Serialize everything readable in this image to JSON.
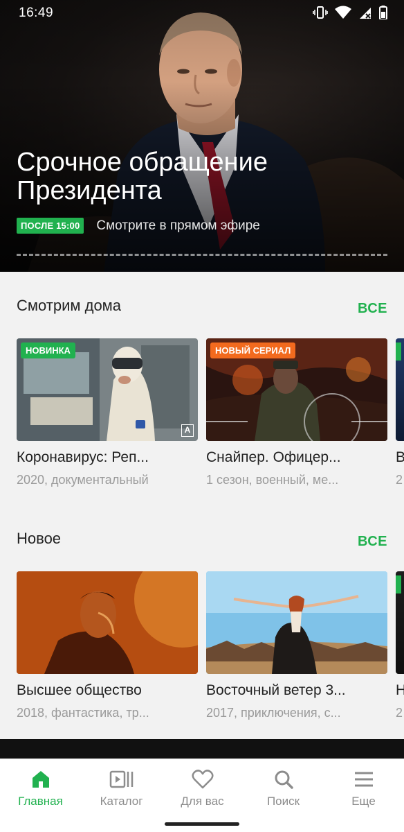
{
  "status_bar": {
    "time": "16:49"
  },
  "hero": {
    "title_line1": "Срочное обращение",
    "title_line2": "Президента",
    "badge": "ПОСЛЕ 15:00",
    "subtitle": "Смотрите в прямом эфире"
  },
  "sections": [
    {
      "title": "Смотрим дома",
      "see_all": "ВСЕ",
      "cards": [
        {
          "badge": "НОВИНКА",
          "title": "Коронавирус: Реп...",
          "meta": "2020, документальный",
          "age_mark": "A"
        },
        {
          "badge": "НОВЫЙ СЕРИАЛ",
          "title": "Снайпер. Офицер...",
          "meta": "1 сезон, военный, ме..."
        }
      ],
      "peek": {
        "title": "В",
        "meta": "2"
      }
    },
    {
      "title": "Новое",
      "see_all": "ВСЕ",
      "cards": [
        {
          "title": "Высшее общество",
          "meta": "2018, фантастика, тр..."
        },
        {
          "title": "Восточный ветер 3...",
          "meta": "2017, приключения, с..."
        }
      ],
      "peek": {
        "title": "Н",
        "meta": "2"
      }
    }
  ],
  "bottom_nav": {
    "items": [
      {
        "label": "Главная",
        "icon": "home-icon",
        "active": true
      },
      {
        "label": "Каталог",
        "icon": "catalog-icon",
        "active": false
      },
      {
        "label": "Для вас",
        "icon": "heart-icon",
        "active": false
      },
      {
        "label": "Поиск",
        "icon": "search-icon",
        "active": false
      },
      {
        "label": "Еще",
        "icon": "menu-icon",
        "active": false
      }
    ]
  },
  "colors": {
    "accent": "#21b14f",
    "badge_orange": "#f26a1e",
    "background": "#f2f2f2"
  }
}
